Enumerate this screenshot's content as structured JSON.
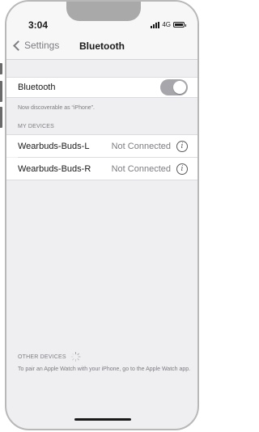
{
  "status_bar": {
    "time": "3:04",
    "network": "4G"
  },
  "nav": {
    "back_label": "Settings",
    "title": "Bluetooth"
  },
  "bluetooth": {
    "label": "Bluetooth",
    "enabled": true,
    "discoverable_text": "Now discoverable as “iPhone”."
  },
  "my_devices": {
    "header": "MY DEVICES",
    "items": [
      {
        "name": "Wearbuds-Buds-L",
        "status": "Not Connected"
      },
      {
        "name": "Wearbuds-Buds-R",
        "status": "Not Connected"
      }
    ]
  },
  "other_devices": {
    "header": "OTHER DEVICES",
    "footnote": "To pair an Apple Watch with your iPhone, go to the Apple Watch app."
  },
  "icons": {
    "back": "chevron-left-icon",
    "info": "info-icon",
    "spinner": "spinner-icon",
    "signal": "signal-icon",
    "battery": "battery-icon"
  }
}
